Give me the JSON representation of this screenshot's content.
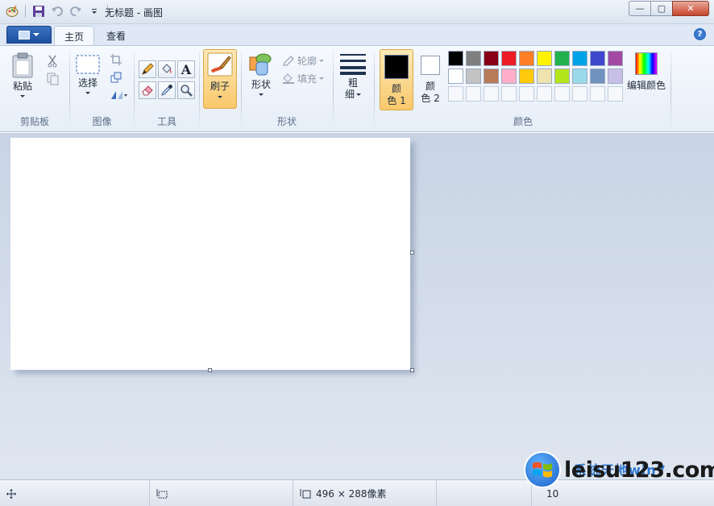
{
  "window": {
    "title": "无标题 - 画图",
    "minimize_glyph": "—",
    "maximize_glyph": "▢",
    "close_glyph": "✕"
  },
  "tabs": [
    {
      "label": "主页",
      "active": true
    },
    {
      "label": "查看",
      "active": false
    }
  ],
  "help_glyph": "?",
  "ribbon": {
    "clipboard": {
      "label": "剪贴板",
      "paste": "粘贴"
    },
    "image": {
      "label": "图像",
      "select": "选择"
    },
    "tools": {
      "label": "工具",
      "text_glyph": "A"
    },
    "brushes": {
      "label": "刷子"
    },
    "shapes": {
      "label": "形状",
      "button": "形状",
      "outline": "轮廓",
      "fill": "填充"
    },
    "size": {
      "line1": "粗",
      "line2": "细"
    },
    "colors": {
      "label": "颜色",
      "color1_line1": "颜",
      "color1_line2": "色 1",
      "color2_line1": "颜",
      "color2_line2": "色 2",
      "color1_value": "#000000",
      "color2_value": "#ffffff",
      "edit": "编辑颜色",
      "palette_row1": [
        "#000000",
        "#7f7f7f",
        "#880015",
        "#ed1c24",
        "#ff7f27",
        "#fff200",
        "#22b14c",
        "#00a2e8",
        "#3f48cc",
        "#a349a4"
      ],
      "palette_row2": [
        "#ffffff",
        "#c3c3c3",
        "#b97a57",
        "#ffaec9",
        "#ffc90e",
        "#efe4b0",
        "#b5e61d",
        "#99d9ea",
        "#7092be",
        "#c8bfe7"
      ]
    }
  },
  "status": {
    "size": "496 × 288像素",
    "zoom": "10"
  },
  "watermark": {
    "text": "leisu123.com",
    "top": "系统天地win7"
  }
}
